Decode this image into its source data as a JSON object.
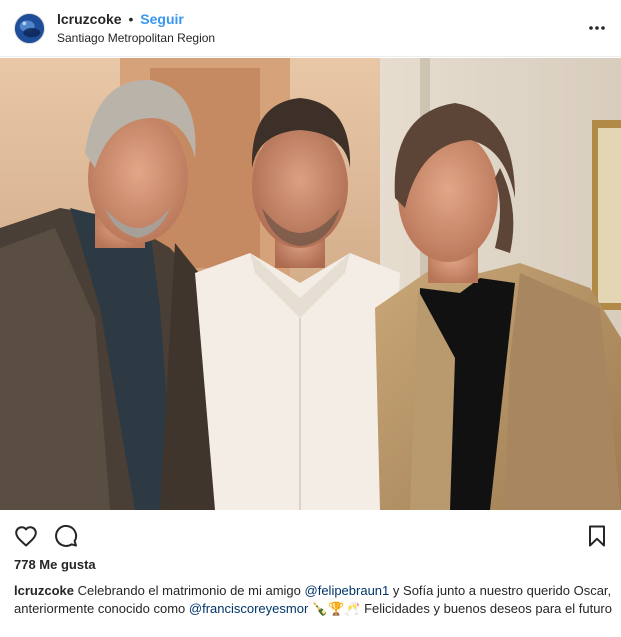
{
  "header": {
    "username": "lcruzcoke",
    "separator": "•",
    "follow_label": "Seguir",
    "location": "Santiago Metropolitan Region",
    "more_icon": "more-horizontal-icon"
  },
  "post": {
    "image_alt": "Tres hombres sonriendo posando juntos en interior",
    "likes_text": "778 Me gusta"
  },
  "actions": {
    "like_icon": "heart-icon",
    "comment_icon": "comment-icon",
    "save_icon": "bookmark-icon"
  },
  "caption": {
    "username": "lcruzcoke",
    "text_1": "Celebrando el matrimonio de mi amigo",
    "mention_1": "@felipebraun1",
    "text_2": "y Sofía junto a nuestro querido Oscar, anteriormente conocido como",
    "mention_2": "@franciscoreyesmor",
    "emoji": "🍾🏆🥂",
    "text_3": "Felicidades y buenos deseos para el futuro"
  },
  "colors": {
    "link_blue": "#3897f0",
    "mention_blue": "#003569",
    "text": "#262626",
    "border": "#efefef"
  }
}
